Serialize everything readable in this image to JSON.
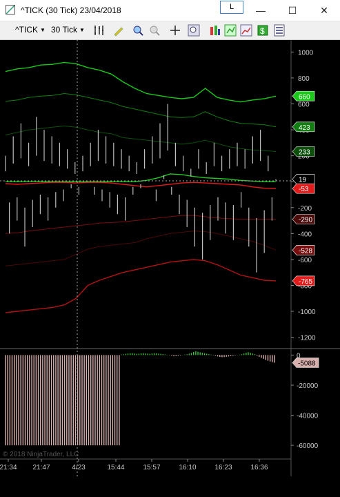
{
  "window": {
    "title": "^TICK (30 Tick)  23/04/2018",
    "l_button": "L",
    "minimize": "—",
    "maximize": "☐",
    "close": "✕"
  },
  "toolbar": {
    "instrument": "^TICK",
    "interval": "30 Tick"
  },
  "watermark": "© 2018 NinjaTrader, LLC",
  "colors": {
    "upper1": "#19c819",
    "upper2": "#127e12",
    "upper3": "#0c500c",
    "middle": "#23c823",
    "lower1": "#b21414",
    "lower2": "#780e0e",
    "lower3": "#4b0a0a",
    "red_mid": "#e21b1b",
    "price": "#bdbdbd",
    "histogram_pos": "#3cc43c",
    "histogram_neg": "#d8b0ad"
  },
  "chart_data": [
    {
      "type": "line",
      "title": "",
      "ylim": [
        -1250,
        1050
      ],
      "y_ticks": [
        1000,
        800,
        600,
        400,
        200,
        0,
        -200,
        -400,
        -600,
        -800,
        -1000,
        -1200
      ],
      "x_ticks": [
        "21:34",
        "21:47",
        "4/23",
        "15:44",
        "15:57",
        "16:10",
        "16:23",
        "16:36"
      ],
      "series": [
        {
          "role": "upper-band-3",
          "color": "#19c819",
          "values": [
            850,
            870,
            880,
            900,
            905,
            920,
            910,
            880,
            860,
            830,
            770,
            720,
            680,
            665,
            650,
            640,
            650,
            720,
            650,
            630,
            615,
            630,
            640,
            660
          ]
        },
        {
          "role": "upper-band-2",
          "color": "#127e12",
          "values": [
            620,
            630,
            650,
            660,
            665,
            680,
            670,
            650,
            630,
            610,
            580,
            560,
            540,
            520,
            500,
            495,
            500,
            540,
            500,
            470,
            450,
            445,
            440,
            423
          ]
        },
        {
          "role": "upper-band-1",
          "color": "#0c500c",
          "values": [
            360,
            380,
            400,
            410,
            420,
            430,
            420,
            400,
            380,
            370,
            340,
            330,
            320,
            310,
            300,
            290,
            300,
            320,
            295,
            270,
            255,
            245,
            240,
            233
          ]
        },
        {
          "role": "middle-band",
          "color": "#23c823",
          "values": [
            0,
            0,
            0,
            0,
            0,
            0,
            0,
            0,
            0,
            0,
            0,
            0,
            10,
            30,
            60,
            55,
            40,
            30,
            25,
            20,
            10,
            5,
            0,
            0
          ]
        },
        {
          "role": "lower-band-1",
          "color": "#e21b1b",
          "values": [
            -15,
            -20,
            -15,
            -10,
            -5,
            -5,
            -10,
            -5,
            -5,
            -10,
            -20,
            -30,
            -40,
            -30,
            -20,
            -10,
            -5,
            -10,
            -15,
            -20,
            -25,
            -40,
            -50,
            -53
          ]
        },
        {
          "role": "lower-band-2",
          "color": "#780e0e",
          "values": [
            -400,
            -395,
            -380,
            -370,
            -360,
            -350,
            -340,
            -330,
            -320,
            -315,
            -310,
            -300,
            -290,
            -280,
            -270,
            -260,
            -260,
            -270,
            -280,
            -285,
            -290,
            -290,
            -290,
            -290
          ]
        },
        {
          "role": "lower-band-3",
          "color": "#4b0a0a",
          "values": [
            -650,
            -640,
            -630,
            -620,
            -610,
            -600,
            -560,
            -520,
            -500,
            -490,
            -480,
            -470,
            -440,
            -420,
            -400,
            -390,
            -380,
            -385,
            -400,
            -420,
            -440,
            -460,
            -490,
            -528
          ]
        },
        {
          "role": "lowest-band",
          "color": "#b21414",
          "values": [
            -1010,
            -1000,
            -990,
            -980,
            -970,
            -950,
            -900,
            -800,
            -760,
            -730,
            -700,
            -680,
            -660,
            -640,
            -620,
            -610,
            -600,
            -610,
            -640,
            -680,
            -720,
            -740,
            -760,
            -765
          ]
        },
        {
          "role": "price",
          "color": "#bdbdbd",
          "values": [
            200,
            -400,
            350,
            -300,
            450,
            -500,
            300,
            -350,
            500,
            -250,
            400,
            -300,
            350,
            -200,
            300,
            -150,
            250,
            -50,
            150,
            -100,
            200,
            0,
            300,
            -100,
            400,
            -150,
            350,
            -200,
            300,
            -250,
            250,
            -300,
            200,
            -100,
            150,
            -50,
            250,
            0,
            350,
            -150,
            450,
            50,
            600,
            -100,
            300,
            -250,
            200,
            -350,
            100,
            -500,
            250,
            -600,
            150,
            -450,
            300,
            -300,
            200,
            -400,
            250,
            -450,
            300,
            -200,
            250,
            -500,
            350,
            -700,
            400,
            -550,
            200,
            -300,
            19
          ]
        }
      ],
      "last_value_labels": [
        {
          "value": 660,
          "color": "#19c819"
        },
        {
          "value": 423,
          "color": "#127e12"
        },
        {
          "value": 233,
          "color": "#0c500c"
        },
        {
          "value": 19,
          "color": "#000000"
        },
        {
          "value": -53,
          "color": "#e21b1b"
        },
        {
          "value": -290,
          "color": "#4b0a0a"
        },
        {
          "value": -528,
          "color": "#780e0e"
        },
        {
          "value": -765,
          "color": "#e21b1b"
        }
      ]
    },
    {
      "type": "bar",
      "title": "",
      "ylim": [
        -65000,
        2000
      ],
      "y_ticks": [
        0,
        -20000,
        -40000,
        -60000
      ],
      "last_value_label": -5088,
      "values": [
        -60000,
        -60000,
        -60000,
        -60000,
        -60000,
        -60000,
        -60000,
        -60000,
        -60000,
        -60000,
        -60000,
        -60000,
        -60000,
        -60000,
        -60000,
        -60000,
        -60000,
        -60000,
        -60000,
        -60000,
        -60000,
        -60000,
        -60000,
        -60000,
        -60000,
        -60000,
        -60000,
        -60000,
        -60000,
        -60000,
        -60000,
        -60000,
        -60000,
        -60000,
        -60000,
        -60000,
        -60000,
        -60000,
        -60000,
        -60000,
        -60000,
        -60000,
        -60000,
        -60000,
        -60000,
        -60000,
        -60000,
        -60000,
        -60000,
        -60000,
        -60000,
        -60000,
        -60000,
        300,
        500,
        800,
        1000,
        1200,
        1200,
        1000,
        800,
        900,
        1100,
        1200,
        1000,
        900,
        800,
        1000,
        1200,
        1100,
        900,
        800,
        600,
        400,
        200,
        -200,
        -500,
        -800,
        -700,
        -500,
        -300,
        100,
        300,
        500,
        900,
        1400,
        2000,
        2500,
        2200,
        1800,
        1500,
        1200,
        900,
        600,
        300,
        -200,
        -500,
        -900,
        -1200,
        -1400,
        -1300,
        -1100,
        -900,
        -700,
        -500,
        -300,
        -100,
        200,
        500,
        1000,
        1500,
        1800,
        1500,
        1000,
        500,
        -500,
        -1200,
        -1800,
        -2500,
        -3200,
        -3800,
        -4300,
        -4700,
        -5088
      ]
    }
  ]
}
